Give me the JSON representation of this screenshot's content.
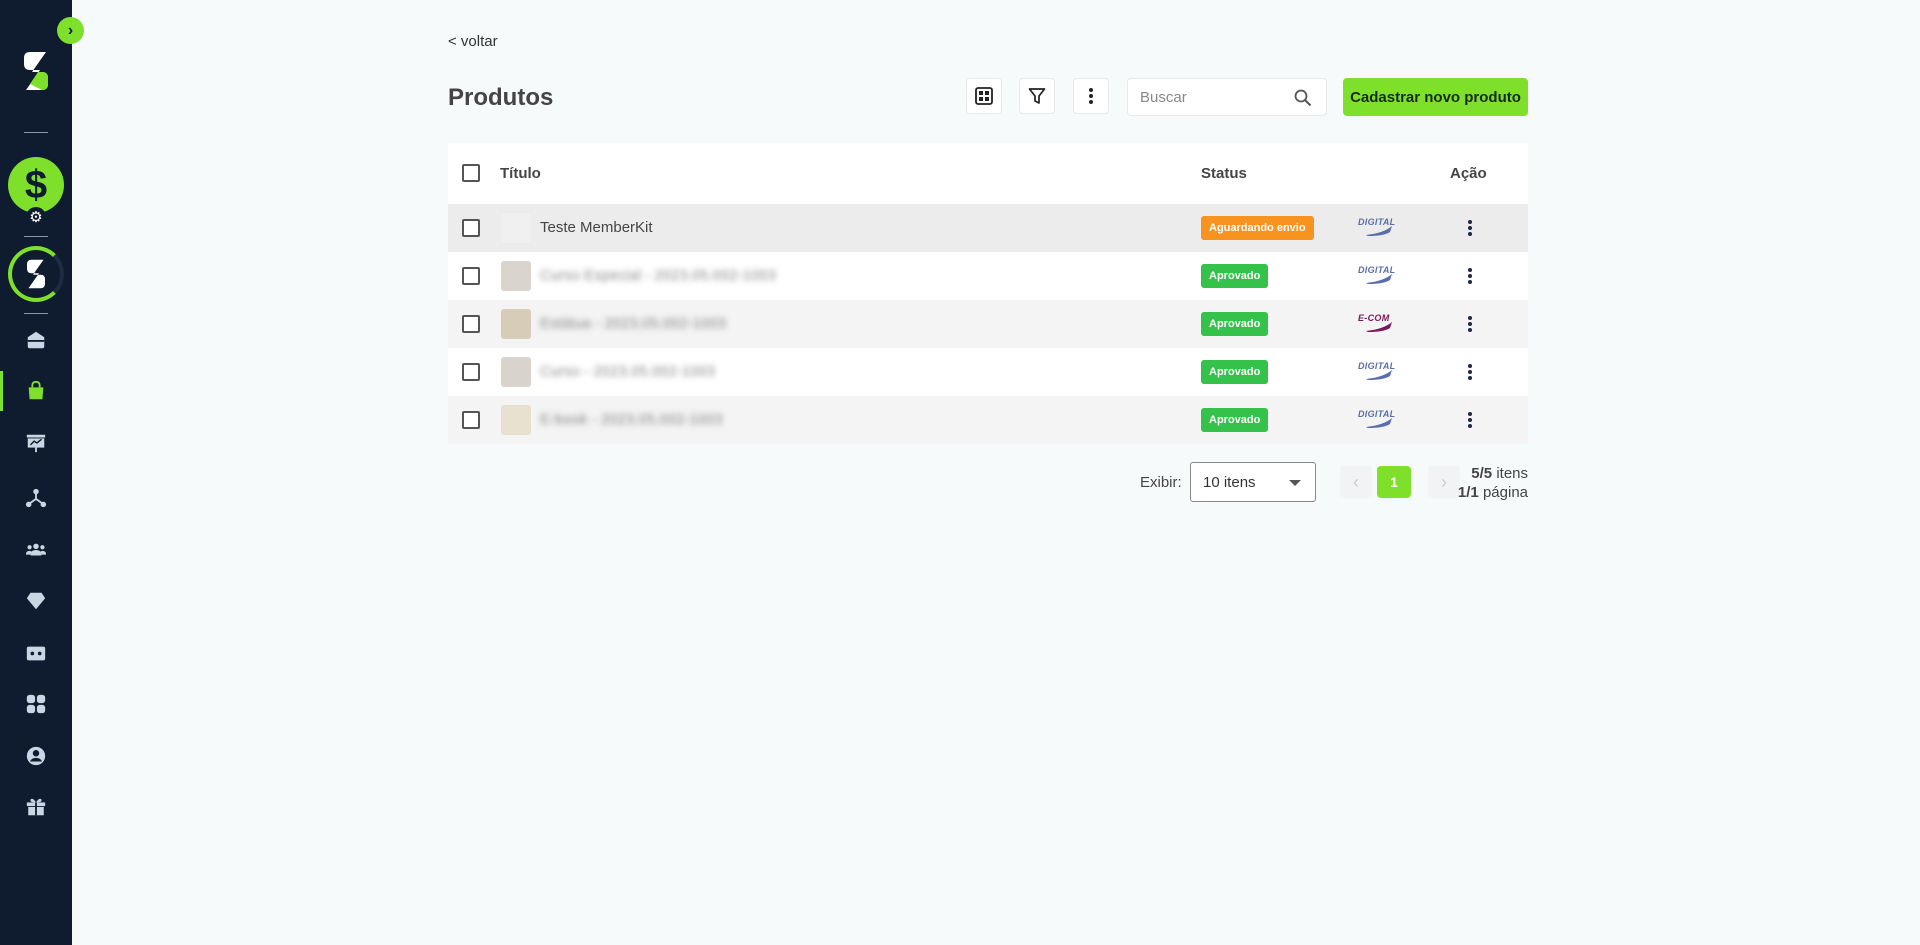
{
  "sidebar": {
    "toggle_glyph": "›",
    "dollar_glyph": "$",
    "gear_glyph": "⚙",
    "items": [
      {
        "name": "home-icon",
        "active": false
      },
      {
        "name": "products-bag-icon",
        "active": true
      },
      {
        "name": "presentation-icon",
        "active": false
      },
      {
        "name": "affiliates-network-icon",
        "active": false
      },
      {
        "name": "users-group-icon",
        "active": false
      },
      {
        "name": "diamond-icon",
        "active": false
      },
      {
        "name": "wallet-icon",
        "active": false
      },
      {
        "name": "apps-grid-icon",
        "active": false
      },
      {
        "name": "account-icon",
        "active": false
      },
      {
        "name": "gift-icon",
        "active": false
      }
    ],
    "accent_color": "#7ee02b",
    "bg_color": "#0f1b2e"
  },
  "header": {
    "back_label": "< voltar",
    "title": "Produtos",
    "search_placeholder": "Buscar",
    "new_product_label": "Cadastrar novo produto"
  },
  "table": {
    "columns": {
      "title": "Título",
      "status": "Status",
      "action": "Ação"
    },
    "rows": [
      {
        "title": "Teste MemberKit",
        "status": "Aguardando envio",
        "status_kind": "warn",
        "type": "DIGITAL",
        "blurred": false
      },
      {
        "title": "Curso Especial - 2023.05.002-1003",
        "status": "Aprovado",
        "status_kind": "ok",
        "type": "DIGITAL",
        "blurred": true
      },
      {
        "title": "Estátua - 2023.05.002-1003",
        "status": "Aprovado",
        "status_kind": "ok",
        "type": "E-COM",
        "blurred": true
      },
      {
        "title": "Curso - 2023.05.002-1003",
        "status": "Aprovado",
        "status_kind": "ok",
        "type": "DIGITAL",
        "blurred": true
      },
      {
        "title": "E-book - 2023.05.002-1003",
        "status": "Aprovado",
        "status_kind": "ok",
        "type": "DIGITAL",
        "blurred": true
      }
    ]
  },
  "pagination": {
    "show_label": "Exibir:",
    "per_page": "10 itens",
    "prev_glyph": "‹",
    "next_glyph": "›",
    "current_page": "1",
    "items_count": "5/5",
    "items_word": "itens",
    "pages_count": "1/1",
    "pages_word": "página"
  },
  "colors": {
    "status_warn": "#f7931e",
    "status_ok": "#34c24a",
    "digital_logo": "#5a6fa8",
    "ecom_logo": "#7a1a5a"
  }
}
